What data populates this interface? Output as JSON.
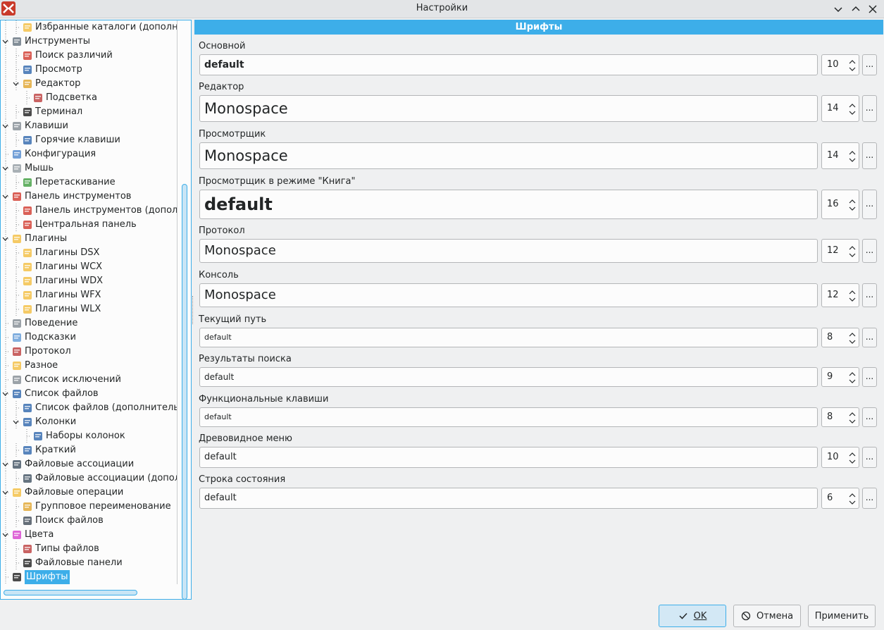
{
  "window": {
    "title": "Настройки",
    "accent": "#3daee9"
  },
  "tree": {
    "items": [
      {
        "label": "Избранные каталоги (дополнит",
        "icon": "folder-star-icon",
        "level": 1
      },
      {
        "label": "Инструменты",
        "icon": "tools-icon",
        "level": 0
      },
      {
        "label": "Поиск различий",
        "icon": "diff-icon",
        "level": 1
      },
      {
        "label": "Просмотр",
        "icon": "book-icon",
        "level": 1
      },
      {
        "label": "Редактор",
        "icon": "edit-icon",
        "level": 1
      },
      {
        "label": "Подсветка",
        "icon": "highlight-icon",
        "level": 2
      },
      {
        "label": "Терминал",
        "icon": "terminal-icon",
        "level": 1
      },
      {
        "label": "Клавиши",
        "icon": "keyboard-icon",
        "level": 0
      },
      {
        "label": "Горячие клавиши",
        "icon": "hotkeys-icon",
        "level": 1
      },
      {
        "label": "Конфигурация",
        "icon": "config-icon",
        "level": 0
      },
      {
        "label": "Мышь",
        "icon": "mouse-icon",
        "level": 0
      },
      {
        "label": "Перетаскивание",
        "icon": "drag-icon",
        "level": 1
      },
      {
        "label": "Панель инструментов",
        "icon": "toolbar-icon",
        "level": 0
      },
      {
        "label": "Панель инструментов (дополни",
        "icon": "toolbar-icon",
        "level": 1
      },
      {
        "label": "Центральная панель",
        "icon": "toolbar-icon",
        "level": 1
      },
      {
        "label": "Плагины",
        "icon": "plugin-icon",
        "level": 0
      },
      {
        "label": "Плагины DSX",
        "icon": "plugin-icon",
        "level": 1
      },
      {
        "label": "Плагины WCX",
        "icon": "plugin-icon",
        "level": 1
      },
      {
        "label": "Плагины WDX",
        "icon": "plugin-icon",
        "level": 1
      },
      {
        "label": "Плагины WFX",
        "icon": "plugin-icon",
        "level": 1
      },
      {
        "label": "Плагины WLX",
        "icon": "plugin-icon",
        "level": 1
      },
      {
        "label": "Поведение",
        "icon": "lock-icon",
        "level": 0
      },
      {
        "label": "Подсказки",
        "icon": "bulb-icon",
        "level": 0
      },
      {
        "label": "Протокол",
        "icon": "log-icon",
        "level": 0
      },
      {
        "label": "Разное",
        "icon": "misc-icon",
        "level": 0
      },
      {
        "label": "Список исключений",
        "icon": "exclude-icon",
        "level": 0
      },
      {
        "label": "Список файлов",
        "icon": "filelist-icon",
        "level": 0
      },
      {
        "label": "Список файлов (дополнительно",
        "icon": "filelist-icon",
        "level": 1
      },
      {
        "label": "Колонки",
        "icon": "columns-icon",
        "level": 1
      },
      {
        "label": "Наборы колонок",
        "icon": "columnsets-icon",
        "level": 2
      },
      {
        "label": "Краткий",
        "icon": "brief-icon",
        "level": 1
      },
      {
        "label": "Файловые ассоциации",
        "icon": "assoc-icon",
        "level": 0
      },
      {
        "label": "Файловые ассоциации (дополни",
        "icon": "assoc-icon",
        "level": 1
      },
      {
        "label": "Файловые операции",
        "icon": "folder-icon",
        "level": 0
      },
      {
        "label": "Групповое переименование",
        "icon": "rename-icon",
        "level": 1
      },
      {
        "label": "Поиск файлов",
        "icon": "binoculars-icon",
        "level": 1
      },
      {
        "label": "Цвета",
        "icon": "colors-icon",
        "level": 0
      },
      {
        "label": "Типы файлов",
        "icon": "filetypes-icon",
        "level": 1
      },
      {
        "label": "Файловые панели",
        "icon": "panels-icon",
        "level": 1
      },
      {
        "label": "Шрифты",
        "icon": "fonts-icon",
        "level": 0,
        "selected": true
      }
    ]
  },
  "fonts_page": {
    "header": "Шрифты",
    "fields": [
      {
        "label": "Основной",
        "value": "default",
        "size": "10",
        "dots": "..."
      },
      {
        "label": "Редактор",
        "value": "Monospace",
        "size": "14",
        "dots": "..."
      },
      {
        "label": "Просмотрщик",
        "value": "Monospace",
        "size": "14",
        "dots": "..."
      },
      {
        "label": "Просмотрщик в режиме \"Книга\"",
        "value": "default",
        "size": "16",
        "dots": "..."
      },
      {
        "label": "Протокол",
        "value": "Monospace",
        "size": "12",
        "dots": "..."
      },
      {
        "label": "Консоль",
        "value": "Monospace",
        "size": "12",
        "dots": "..."
      },
      {
        "label": "Текущий путь",
        "value": "default",
        "size": "8",
        "dots": "..."
      },
      {
        "label": "Результаты поиска",
        "value": "default",
        "size": "9",
        "dots": "..."
      },
      {
        "label": "Функциональные клавиши",
        "value": "default",
        "size": "8",
        "dots": "..."
      },
      {
        "label": "Древовидное меню",
        "value": "default",
        "size": "10",
        "dots": "..."
      },
      {
        "label": "Строка состояния",
        "value": "default",
        "size": "6",
        "dots": "..."
      }
    ]
  },
  "buttons": {
    "ok": "OK",
    "cancel": "Отмена",
    "apply": "Применить"
  }
}
